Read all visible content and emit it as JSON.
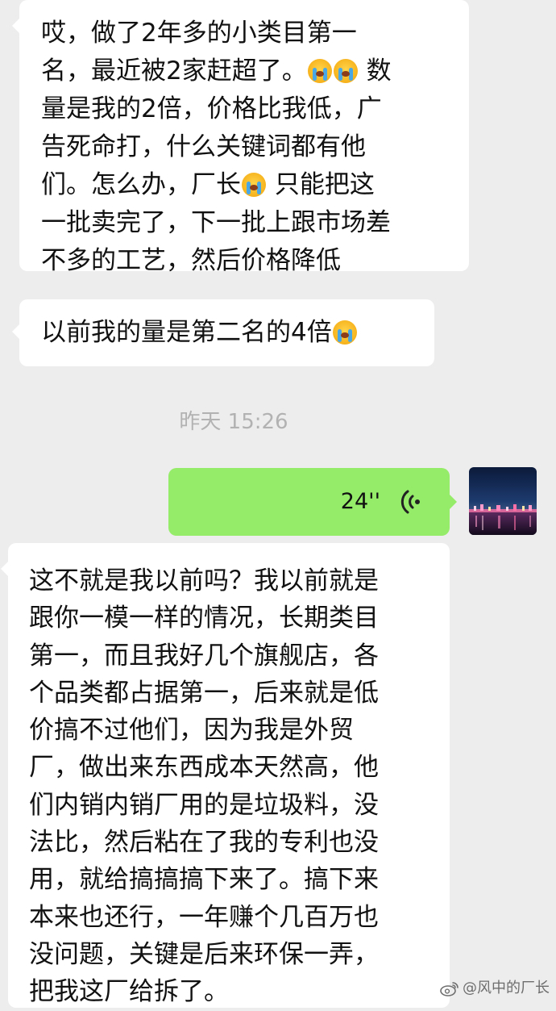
{
  "messages": [
    {
      "segments": [
        "哎，做了2年多的小类目第一\n名，最近被2家赶超了。",
        " 数\n量是我的2倍，价格比我低，广\n告死命打，什么关键词都有他\n们。怎么办，厂长",
        " 只能把这\n一批卖完了，下一批上跟市场差\n不多的工艺，然后价格降低"
      ]
    },
    {
      "segments": [
        "以前我的量是第二名的4倍"
      ]
    },
    {
      "segments": [
        "这不就是我以前吗？我以前就是\n跟你一模一样的情况，长期类目\n第一，而且我好几个旗舰店，各\n个品类都占据第一，后来就是低\n价搞不过他们，因为我是外贸\n厂，做出来东西成本天然高，他\n们内销内销厂用的是垃圾料，没\n法比，然后粘在了我的专利也没\n用，就给搞搞搞下来了。搞下来\n本来也还行，一年赚个几百万也\n没问题，关键是后来环保一弄，\n把我这厂给拆了。"
      ]
    }
  ],
  "timestamp": "昨天 15:26",
  "voice_message": {
    "duration": "24''",
    "icon": "voice-wave-icon"
  },
  "avatar": {
    "icon": "night-city-avatar"
  },
  "emoji": {
    "name": "loudly-crying-face-emoji"
  },
  "watermark": {
    "text": "@风中的厂长",
    "icon": "weibo-icon"
  },
  "colors": {
    "background": "#ededed",
    "incoming_bubble": "#ffffff",
    "outgoing_bubble": "#95ec69",
    "timestamp_text": "#b2b2b2"
  }
}
